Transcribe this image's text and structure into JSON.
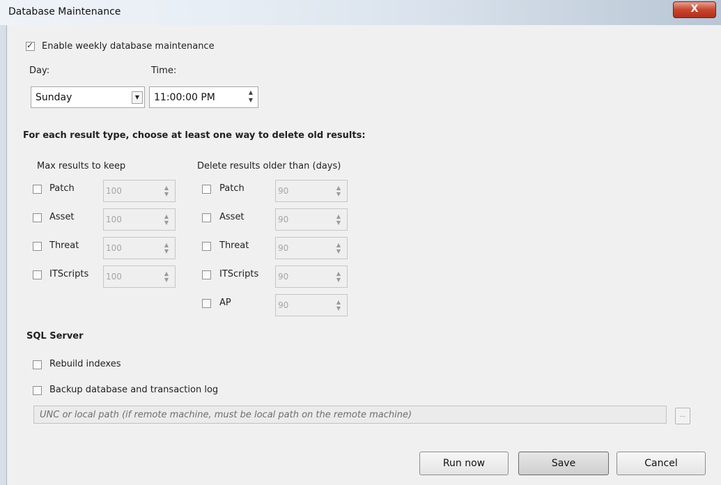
{
  "window": {
    "title": "Database Maintenance",
    "close_label": "X"
  },
  "enable": {
    "label": "Enable weekly database maintenance",
    "checked": true
  },
  "schedule": {
    "day_label": "Day:",
    "day_value": "Sunday",
    "time_label": "Time:",
    "time_value": "11:00:00 PM"
  },
  "results": {
    "heading": "For each result type, choose at least one way to delete old results:",
    "max_heading": "Max results to keep",
    "age_heading": "Delete results older than (days)",
    "max_items": [
      {
        "label": "Patch",
        "value": "100"
      },
      {
        "label": "Asset",
        "value": "100"
      },
      {
        "label": "Threat",
        "value": "100"
      },
      {
        "label": "ITScripts",
        "value": "100"
      }
    ],
    "age_items": [
      {
        "label": "Patch",
        "value": "90"
      },
      {
        "label": "Asset",
        "value": "90"
      },
      {
        "label": "Threat",
        "value": "90"
      },
      {
        "label": "ITScripts",
        "value": "90"
      },
      {
        "label": "AP",
        "value": "90"
      }
    ]
  },
  "sql": {
    "heading": "SQL Server",
    "rebuild_label": "Rebuild indexes",
    "backup_label": "Backup database and transaction log",
    "path_placeholder": "UNC or local path (if remote machine, must be local path on the remote machine)",
    "browse_label": "..."
  },
  "buttons": {
    "run_now": "Run now",
    "save": "Save",
    "cancel": "Cancel"
  }
}
